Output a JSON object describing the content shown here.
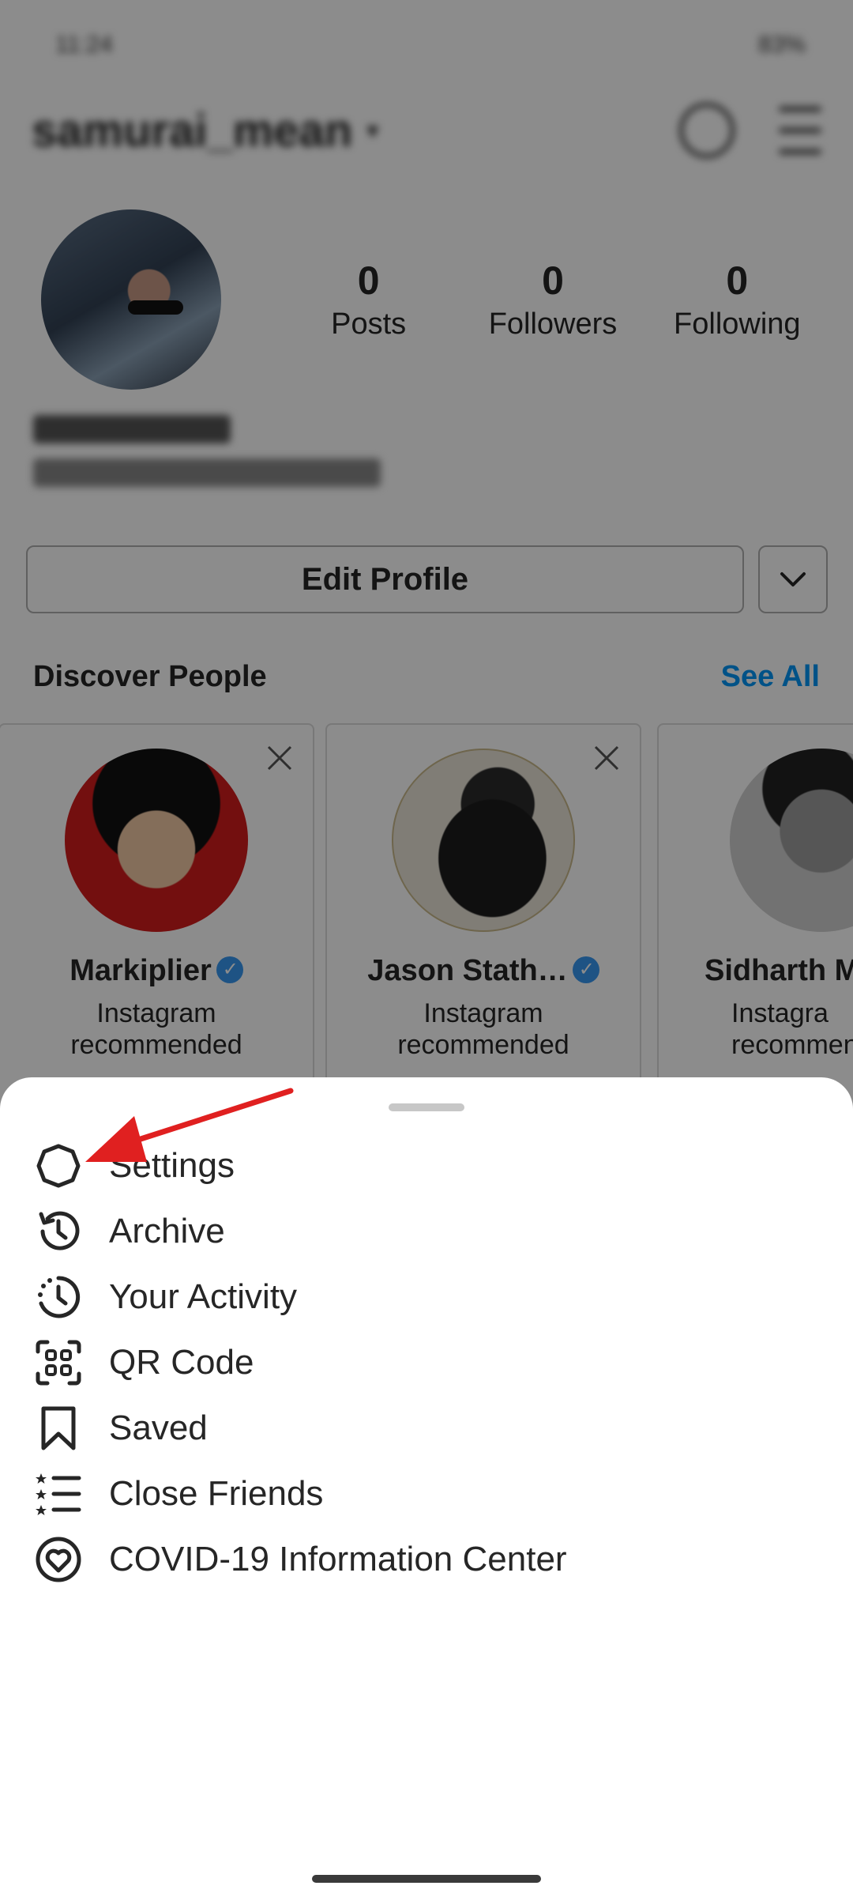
{
  "status_bar": {
    "time": "11:24",
    "battery": "83%"
  },
  "profile": {
    "username": "samurai_mean",
    "stats": [
      {
        "value": "0",
        "label": "Posts"
      },
      {
        "value": "0",
        "label": "Followers"
      },
      {
        "value": "0",
        "label": "Following"
      }
    ],
    "edit_profile_label": "Edit Profile"
  },
  "discover": {
    "title": "Discover People",
    "see_all_label": "See All",
    "cards": [
      {
        "name": "Markiplier",
        "subtitle_line1": "Instagram",
        "subtitle_line2": "recommended",
        "verified": true
      },
      {
        "name": "Jason Stath…",
        "subtitle_line1": "Instagram",
        "subtitle_line2": "recommended",
        "verified": true
      },
      {
        "name": "Sidharth M",
        "subtitle_line1": "Instagra",
        "subtitle_line2": "recommen",
        "verified": false
      }
    ]
  },
  "sheet": {
    "items": [
      {
        "label": "Settings",
        "icon": "gear-icon"
      },
      {
        "label": "Archive",
        "icon": "archive-icon"
      },
      {
        "label": "Your Activity",
        "icon": "activity-icon"
      },
      {
        "label": "QR Code",
        "icon": "qr-code-icon"
      },
      {
        "label": "Saved",
        "icon": "bookmark-icon"
      },
      {
        "label": "Close Friends",
        "icon": "close-friends-icon"
      },
      {
        "label": "COVID-19 Information Center",
        "icon": "covid-info-icon"
      }
    ]
  },
  "annotation": {
    "arrow_color": "#e02020"
  },
  "colors": {
    "accent": "#0095f6",
    "verified": "#3897f0"
  }
}
